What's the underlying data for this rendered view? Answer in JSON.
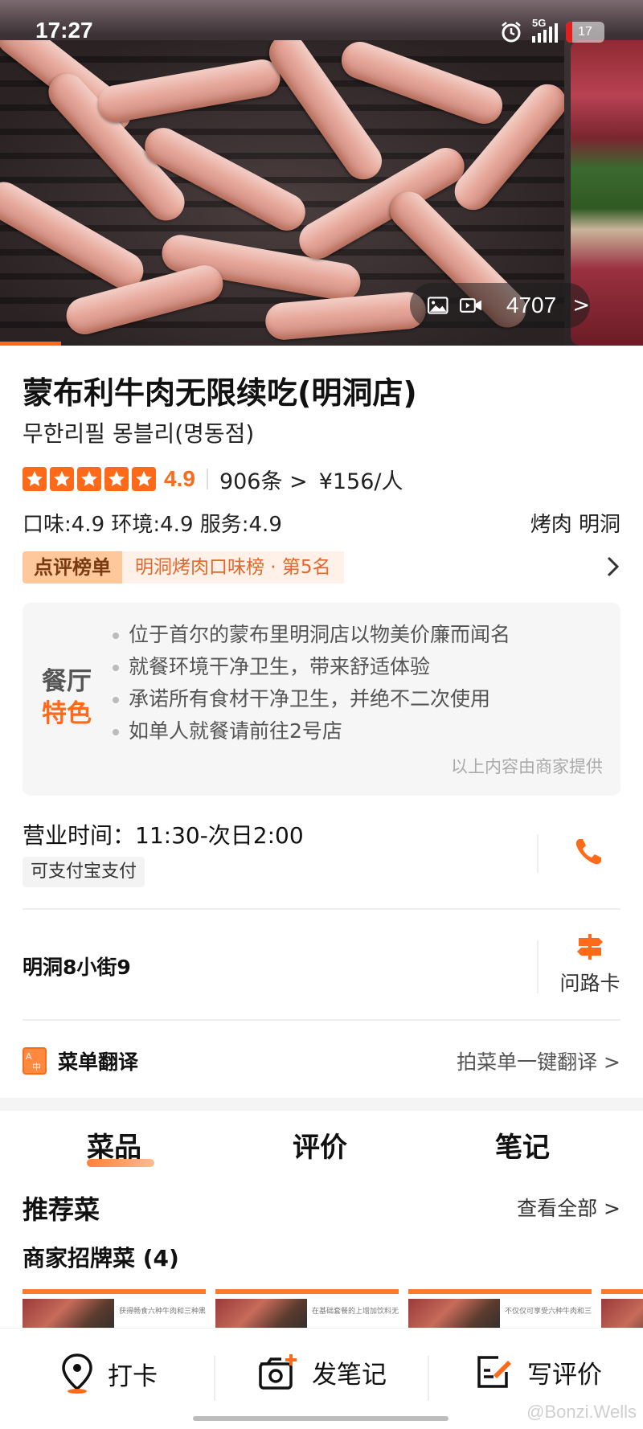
{
  "status_bar": {
    "time": "17:27",
    "network": "5G",
    "battery": "17"
  },
  "hero": {
    "media_count": "4707",
    "chevron": ">"
  },
  "restaurant": {
    "name": "蒙布利牛肉无限续吃(明洞店)",
    "local_name": "무한리필 몽블리(명동점)",
    "rating": "4.9",
    "stars": 5,
    "review_count": "906条 >",
    "price": "¥156/人",
    "subscores": "口味:4.9 环境:4.9 服务:4.9",
    "tags": "烤肉 明洞"
  },
  "ranking": {
    "badge": "点评榜单",
    "text": "明洞烤肉口味榜 · 第5名"
  },
  "features": {
    "label_line1": "餐厅",
    "label_line2": "特色",
    "items": [
      "位于首尔的蒙布里明洞店以物美价廉而闻名",
      "就餐环境干净卫生，带来舒适体验",
      "承诺所有食材干净卫生，并绝不二次使用",
      "如单人就餐请前往2号店"
    ],
    "note": "以上内容由商家提供"
  },
  "info": {
    "hours": "营业时间：11:30-次日2:00",
    "payment": "可支付宝支付",
    "address": "明洞8小街9",
    "route_label": "问路卡"
  },
  "menu_translate": {
    "title": "菜单翻译",
    "cta": "拍菜单一键翻译 >"
  },
  "tabs": [
    "菜品",
    "评价",
    "笔记"
  ],
  "dishes_section": {
    "recommended": "推荐菜",
    "see_all": "查看全部 >",
    "signature": "商家招牌菜 (4)",
    "cards": [
      "获得畅食六种牛肉和三种黑猪肉",
      "在基础套餐的上增加饮料无限畅饮",
      "不仅仅可享受六种牛肉和三种黑猪",
      ""
    ]
  },
  "bottom_bar": {
    "checkin": "打卡",
    "post_note": "发笔记",
    "write_review": "写评价"
  },
  "watermark": "@Bonzi.Wells",
  "colors": {
    "accent": "#ff6a1a",
    "rank_badge_bg": "#ffc89c",
    "feature_bg": "#f6f6f6"
  }
}
